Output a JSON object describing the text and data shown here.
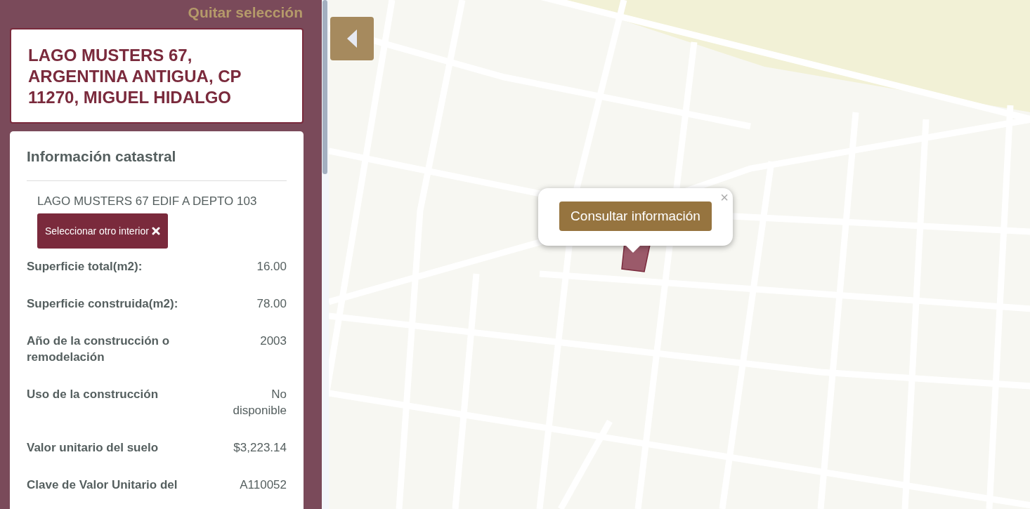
{
  "clear_selection": "Quitar selección",
  "address_title": "LAGO MUSTERS 67, ARGENTINA ANTIGUA, CP 11270, MIGUEL HIDALGO",
  "cadastral": {
    "title": "Información catastral",
    "unit": "LAGO MUSTERS 67 EDIF A DEPTO 103",
    "change_unit_button": "Seleccionar otro interior",
    "fields": [
      {
        "label": "Superficie total(m2):",
        "value": "16.00"
      },
      {
        "label": "Superficie construida(m2):",
        "value": "78.00"
      },
      {
        "label": "Año de la construcción o remodelación",
        "value": "2003"
      },
      {
        "label": "Uso de la construcción",
        "value": "No disponible"
      },
      {
        "label": "Valor unitario del suelo",
        "value": "$3,223.14"
      },
      {
        "label": "Clave de Valor Unitario del",
        "value": "A110052"
      }
    ]
  },
  "map": {
    "popup": {
      "button": "Consultar información",
      "close": "×"
    }
  }
}
